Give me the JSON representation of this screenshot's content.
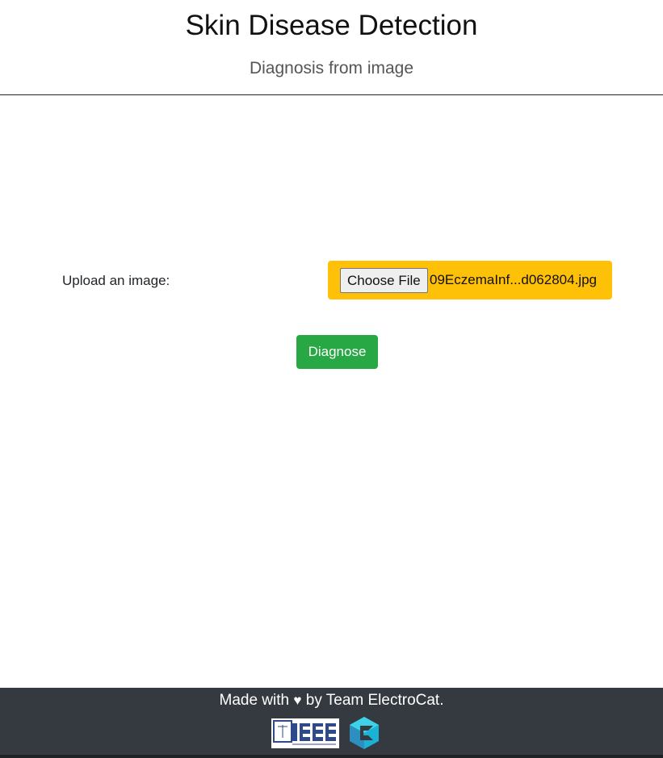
{
  "header": {
    "title": "Skin Disease Detection",
    "subtitle": "Diagnosis from image"
  },
  "upload": {
    "label": "Upload an image:",
    "choose_file_label": "Choose File",
    "file_name": "09EczemaInf...d062804.jpg",
    "box_color": "#ffc107"
  },
  "diagnose": {
    "label": "Diagnose",
    "color": "#28a745"
  },
  "footer": {
    "text_before": "Made with",
    "heart": "♥",
    "text_after": "by Team ElectroCat.",
    "background": "#343a40",
    "logos": [
      "ieee-logo",
      "electrocat-logo"
    ]
  }
}
